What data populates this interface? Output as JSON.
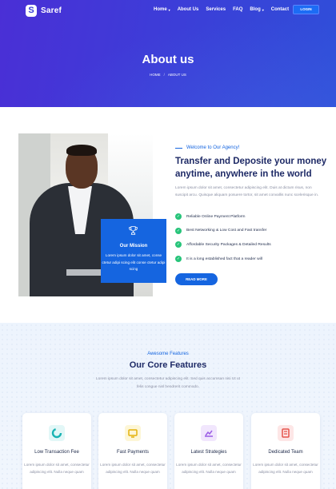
{
  "brand": {
    "name": "Saref",
    "logo_letter": "S"
  },
  "nav": {
    "items": [
      {
        "label": "Home",
        "has_dropdown": true
      },
      {
        "label": "About Us",
        "has_dropdown": false
      },
      {
        "label": "Services",
        "has_dropdown": false
      },
      {
        "label": "FAQ",
        "has_dropdown": false
      },
      {
        "label": "Blog",
        "has_dropdown": true
      },
      {
        "label": "Contact",
        "has_dropdown": false
      }
    ],
    "login_label": "LOGIN",
    "dropdown_glyph": "▾"
  },
  "hero": {
    "title": "About us",
    "breadcrumb": {
      "home": "HOME",
      "separator": "/",
      "current": "ABOUT US"
    }
  },
  "mission": {
    "title": "Our Mission",
    "text": "Lorem ipsum dolor sit amet, conse ctetur adipi scing elit conse ctetur adipi scing",
    "icon": "trophy-icon"
  },
  "about": {
    "eyebrow": "Welcome to Our Agency!",
    "title": "Transfer and Deposite your money anytime, anywhere in the world",
    "text": "Lorem ipsum dolor sit amet, consectetur adipiscing elit. Duis at dictum risus, non suscipit arcu. Quisque aliquam posuere tortor, sit amet convallis nunc scelerisque in.",
    "features": [
      "Reliable Online Payment Platform",
      "Best Networking & Low Cost and Fast transfer",
      "Affordable Security Packages & Detailed Results",
      "It is a long established fact that a reader will"
    ],
    "check_glyph": "✓",
    "read_more": "READ MORE"
  },
  "core": {
    "eyebrow": "Awesome Features",
    "title": "Our Core Features",
    "text": "Lorem ipsum dolor sit amet, consectetur adipiscing elit. Sed quis accumsan nisi Ut ut felis congue nisl hendrerit commodo.",
    "cards": [
      {
        "title": "Low Transaction Fee",
        "text": "Lorem ipsum dolor sit amet, consectetur adipiscing elit. Nulla neque quam",
        "icon": "pie-chart-icon",
        "icon_bg": "#e2f7f7",
        "icon_color": "#19b3b3"
      },
      {
        "title": "Fast Payments",
        "text": "Lorem ipsum dolor sit amet, consectetur adipiscing elit. Nulla neque quam",
        "icon": "monitor-icon",
        "icon_bg": "#fdf6d6",
        "icon_color": "#e3b20b"
      },
      {
        "title": "Latest Strategies",
        "text": "Lorem ipsum dolor sit amet, consectetur adipiscing elit. Nulla neque quam",
        "icon": "chart-icon",
        "icon_bg": "#f1e6fd",
        "icon_color": "#9b5de5"
      },
      {
        "title": "Dedicated Team",
        "text": "Lorem ipsum dolor sit amet, consectetur adipiscing elit. Nulla neque quam",
        "icon": "document-icon",
        "icon_bg": "#fde6e6",
        "icon_color": "#e5534b"
      }
    ]
  },
  "colors": {
    "hero_start": "#4a2fd6",
    "hero_end": "#2f4fd9",
    "accent": "#1565e0",
    "heading": "#1e2a66",
    "check": "#27c47a",
    "core_bg": "#edf4fd"
  }
}
